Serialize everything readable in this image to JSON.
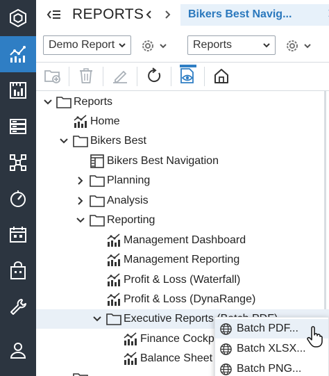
{
  "header": {
    "title": "REPORTS",
    "tab_label": "Bikers Best Navig...",
    "prev_icon": "chevron-left-icon",
    "next_icon": "chevron-right-icon",
    "close_icon": "close-icon"
  },
  "selectors": {
    "left": "Demo Report",
    "right": "Reports"
  },
  "rail": {
    "items": [
      "hexagon-logo-icon",
      "analytics-icon",
      "ruler-chart-icon",
      "server-icon",
      "hierarchy-icon",
      "dashboard-gauge-icon",
      "calendar-icon",
      "shopping-bag-icon",
      "wrench-icon",
      "user-icon"
    ],
    "active": 1
  },
  "toolbar": {
    "items": [
      "new-folder-icon",
      "delete-icon",
      "edit-icon",
      "refresh-icon",
      "preview-icon",
      "home-icon"
    ]
  },
  "tree": {
    "rows": [
      {
        "label": "Reports"
      },
      {
        "label": "Home"
      },
      {
        "label": "Bikers Best"
      },
      {
        "label": "Bikers Best Navigation"
      },
      {
        "label": "Planning"
      },
      {
        "label": "Analysis"
      },
      {
        "label": "Reporting"
      },
      {
        "label": "Management Dashboard"
      },
      {
        "label": "Management Reporting"
      },
      {
        "label": "Profit & Loss (Waterfall)"
      },
      {
        "label": "Profit & Loss (DynaRange)"
      },
      {
        "label": "Executive Reports (Batch PDF)"
      },
      {
        "label": "Finance Cockpit"
      },
      {
        "label": "Balance Sheet"
      }
    ]
  },
  "context_menu": {
    "items": [
      {
        "label": "Batch PDF..."
      },
      {
        "label": "Batch XLSX..."
      },
      {
        "label": "Batch PNG..."
      }
    ]
  },
  "colors": {
    "rail_bg": "#2c3540",
    "accent": "#2f7ec4",
    "tab_bg": "#e7f1fa",
    "selected_row": "#e9f0f7"
  }
}
